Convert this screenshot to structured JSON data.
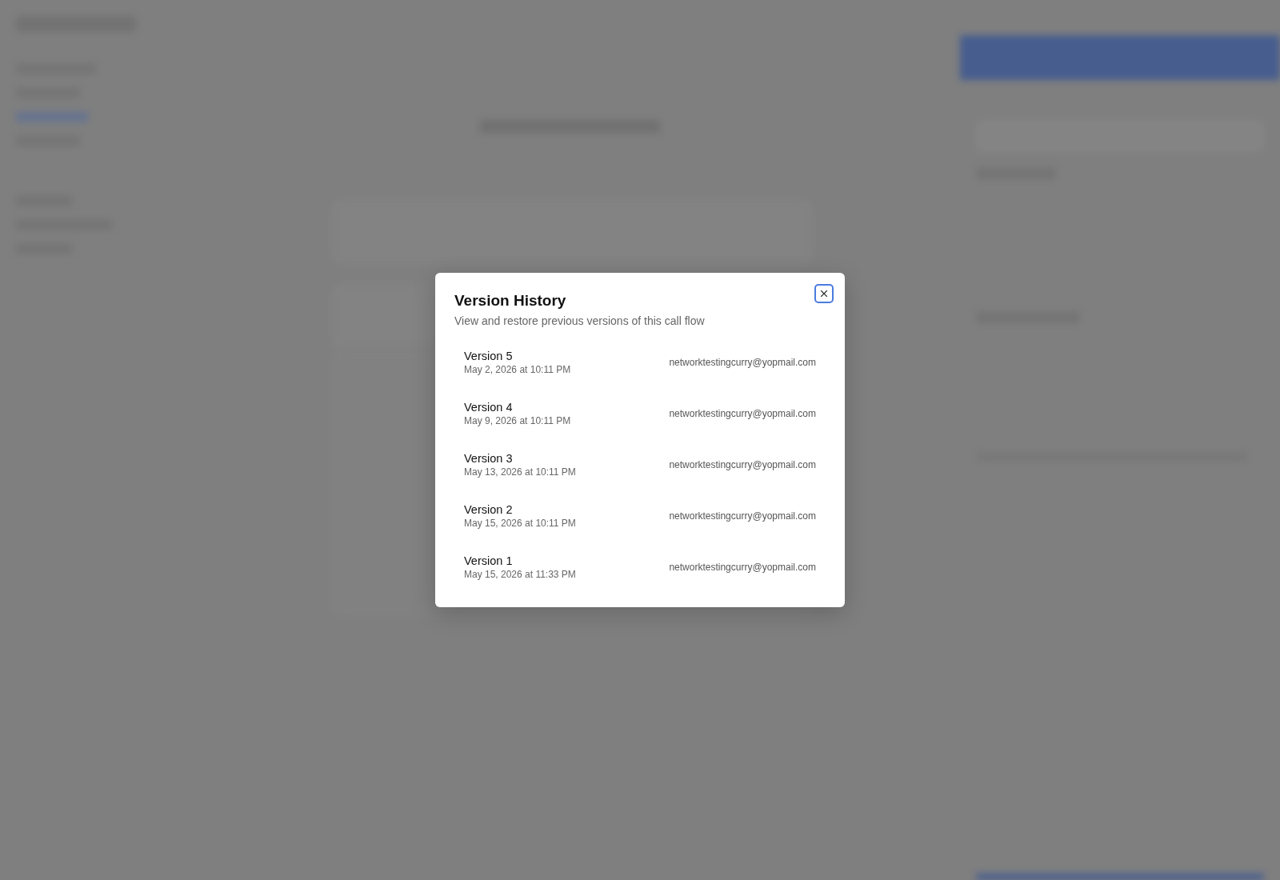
{
  "dialog": {
    "title": "Version History",
    "description": "View and restore previous versions of this call flow",
    "versions": [
      {
        "name": "Version 5",
        "date": "May 2, 2026 at 10:11 PM",
        "author": "networktestingcurry@yopmail.com"
      },
      {
        "name": "Version 4",
        "date": "May 9, 2026 at 10:11 PM",
        "author": "networktestingcurry@yopmail.com"
      },
      {
        "name": "Version 3",
        "date": "May 13, 2026 at 10:11 PM",
        "author": "networktestingcurry@yopmail.com"
      },
      {
        "name": "Version 2",
        "date": "May 15, 2026 at 10:11 PM",
        "author": "networktestingcurry@yopmail.com"
      },
      {
        "name": "Version 1",
        "date": "May 15, 2026 at 11:33 PM",
        "author": "networktestingcurry@yopmail.com"
      }
    ]
  }
}
